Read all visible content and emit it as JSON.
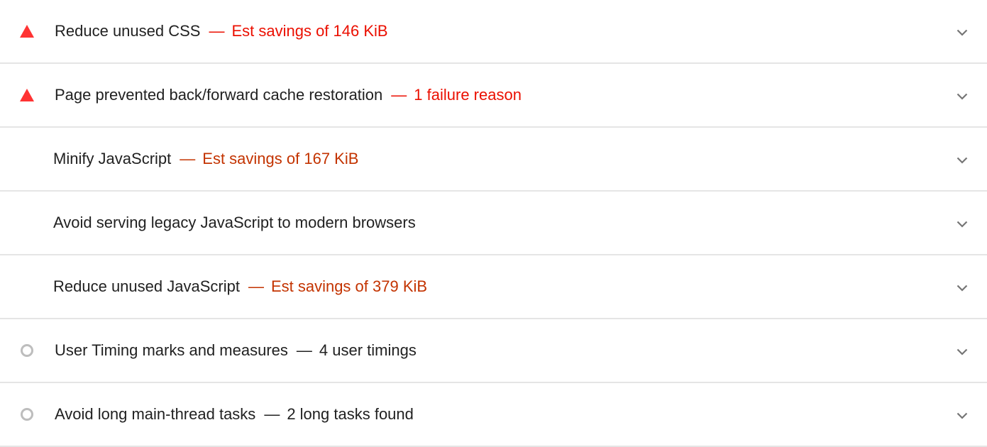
{
  "colors": {
    "fail": "#eb0f00",
    "fail_icon": "#ff3333",
    "average": "#c33300",
    "neutral_icon": "#bdbdbd",
    "divider": "#e5e5e5",
    "chevron": "#757575"
  },
  "audits": [
    {
      "icon": "fail-triangle-icon",
      "status": "fail",
      "title": "Reduce unused CSS",
      "dash": "—",
      "display_value": "Est savings of 146 KiB"
    },
    {
      "icon": "fail-triangle-icon",
      "status": "fail",
      "title": "Page prevented back/forward cache restoration",
      "dash": "—",
      "display_value": "1 failure reason"
    },
    {
      "icon": "",
      "status": "average",
      "title": "Minify JavaScript",
      "dash": "—",
      "display_value": "Est savings of 167 KiB"
    },
    {
      "icon": "",
      "status": "average",
      "title": "Avoid serving legacy JavaScript to modern browsers",
      "dash": "",
      "display_value": ""
    },
    {
      "icon": "",
      "status": "average",
      "title": "Reduce unused JavaScript",
      "dash": "—",
      "display_value": "Est savings of 379 KiB"
    },
    {
      "icon": "info-circle-icon",
      "status": "neutral",
      "title": "User Timing marks and measures",
      "dash": "—",
      "display_value": "4 user timings"
    },
    {
      "icon": "info-circle-icon",
      "status": "neutral",
      "title": "Avoid long main-thread tasks",
      "dash": "—",
      "display_value": "2 long tasks found"
    }
  ]
}
